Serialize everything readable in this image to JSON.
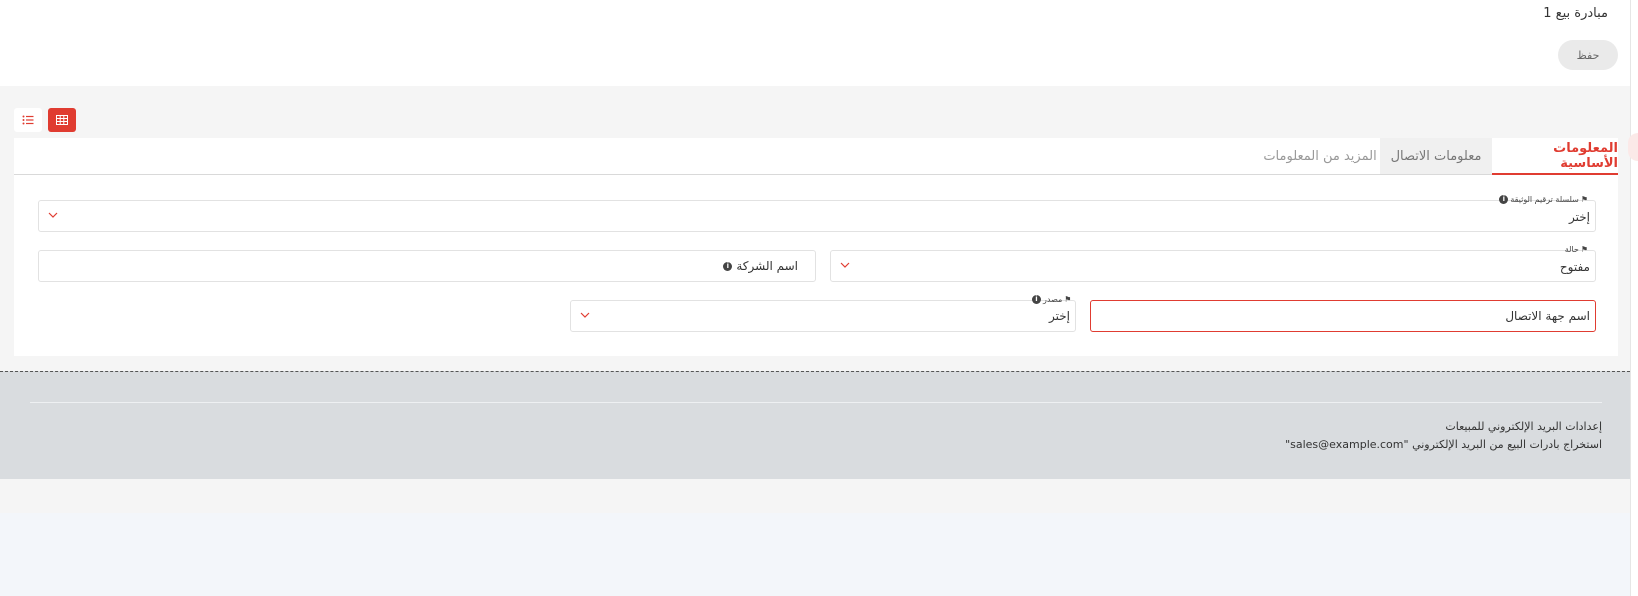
{
  "header": {
    "title": "مبادرة بيع 1",
    "save_label": "حفظ"
  },
  "view_toggle": {
    "grid_icon": "grid-icon",
    "list_icon": "list-icon"
  },
  "tabs": [
    {
      "label": "المعلومات الأساسية",
      "active": true
    },
    {
      "label": "معلومات الاتصال",
      "active": false
    },
    {
      "label": "المزيد من المعلومات",
      "active": false
    }
  ],
  "form": {
    "naming_series": {
      "label": "سلسلة ترقيم الوثيقة",
      "value": "إختر"
    },
    "status": {
      "label": "حالة",
      "value": "مفتوح"
    },
    "company_name": {
      "placeholder": "اسم الشركة"
    },
    "contact_name": {
      "placeholder": "اسم جهة الاتصال"
    },
    "source": {
      "label": "مصدر",
      "value": "إختر"
    }
  },
  "footer": {
    "title": "إعدادات البريد الإلكتروني للمبيعات",
    "description": "استخراج بادرات البيع من البريد الإلكتروني \"sales@example.com\""
  },
  "colors": {
    "accent": "#e03c31",
    "footer_bg": "#d9dcdf"
  }
}
